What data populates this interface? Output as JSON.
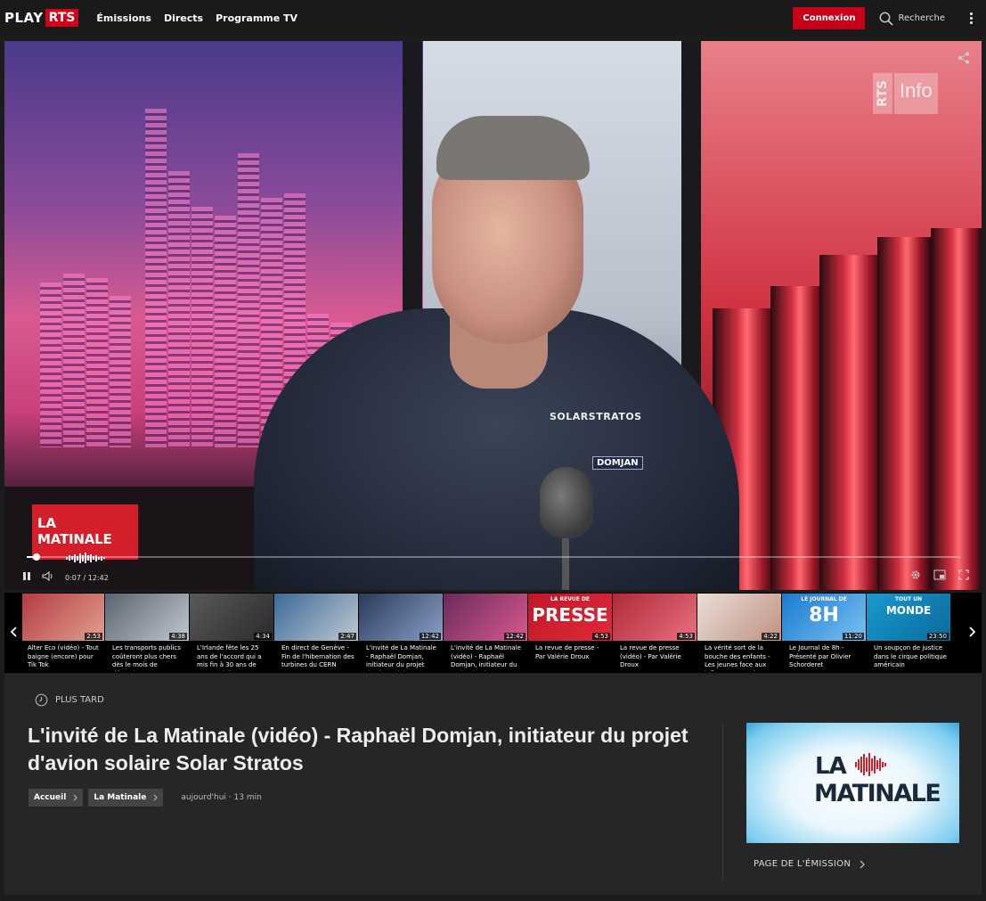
{
  "header": {
    "logo_play": "PLAY",
    "logo_rts": "RTS",
    "nav": [
      "Émissions",
      "Directs",
      "Programme TV"
    ],
    "login_label": "Connexion",
    "search_label": "Recherche"
  },
  "player": {
    "channel_logo_a": "RTS",
    "channel_logo_b": "Info",
    "show_badge": "LA MATINALE",
    "patch_brand": "SOLARSTRATOS",
    "patch_name": "DOMJAN",
    "time_display": "0:07 / 12:42",
    "progress": 0.009
  },
  "playlist": [
    {
      "duration": "2:53",
      "caption": "",
      "colors": [
        "#c33",
        "#6a2a2a"
      ]
    },
    {
      "duration": "2:53",
      "caption": "Alter Eco (vidéo) - Tout baigne (encore) pour Tik Tok",
      "colors": [
        "#b43a40",
        "#e0a090"
      ]
    },
    {
      "duration": "4:38",
      "caption": "Les transports publics coûteront plus chers dès le mois de décembre:…",
      "colors": [
        "#5a6470",
        "#c0c8d0"
      ]
    },
    {
      "duration": "4:34",
      "caption": "L'Irlande fête les 25 ans de l'accord qui a mis fin à 30 ans de guerre civile",
      "colors": [
        "#5a5a5a",
        "#2a2a2a"
      ]
    },
    {
      "duration": "2:47",
      "caption": "En direct de Genève - Fin de l'hibernation des turbines du CERN",
      "colors": [
        "#3a6a9a",
        "#c0c8d0"
      ]
    },
    {
      "duration": "12:42",
      "caption": "L'invité de La Matinale - Raphaël Domjan, initiateur du projet d'avion solaire…",
      "colors": [
        "#2a3a5a",
        "#8aa0c8"
      ]
    },
    {
      "duration": "12:42",
      "caption": "L'invité de La Matinale (vidéo) - Raphaël Domjan, initiateur du projet d'avio…",
      "colors": [
        "#6a2a5a",
        "#d85a90"
      ]
    },
    {
      "duration": "4:53",
      "caption": "La revue de presse - Par Valérie Droux",
      "colors": [
        "#c01828",
        "#e02a3a"
      ]
    },
    {
      "duration": "4:53",
      "caption": "La revue de presse (vidéo) - Par Valérie Droux",
      "colors": [
        "#b02a3a",
        "#e87080"
      ]
    },
    {
      "duration": "4:22",
      "caption": "La vérité sort de la bouche des enfants - Les jeunes face aux influenceurs et à…",
      "colors": [
        "#e8e0d8",
        "#c09080"
      ]
    },
    {
      "duration": "11:20",
      "caption": "Le Journal de 8h - Présenté par Olivier Schorderet",
      "colors": [
        "#1a7ad0",
        "#7ac0f0"
      ]
    },
    {
      "duration": "23:50",
      "caption": "Un soupçon de justice dans le cirque politique américain",
      "colors": [
        "#1a9ad0",
        "#0a6a9a"
      ]
    }
  ],
  "thumb_texts": {
    "revue_top": "LA REVUE DE",
    "revue_big": "PRESSE",
    "journal_top": "LE JOURNAL DE",
    "journal_big": "8H",
    "monde_top": "TOUT UN",
    "monde_big": "MONDE"
  },
  "info": {
    "later_label": "PLUS TARD",
    "title": "L'invité de La Matinale (vidéo) - Raphaël Domjan, initiateur du projet d'avion solaire Solar Stratos",
    "crumbs": [
      "Accueil",
      "La Matinale"
    ],
    "meta": "aujourd'hui  ·  13 min",
    "show_la": "LA",
    "show_matinale": "MATINALE",
    "show_link": "PAGE DE L'ÉMISSION"
  },
  "colors": {
    "brand_red": "#d4001a",
    "background": "#1c1c1c",
    "panel": "#262626"
  }
}
